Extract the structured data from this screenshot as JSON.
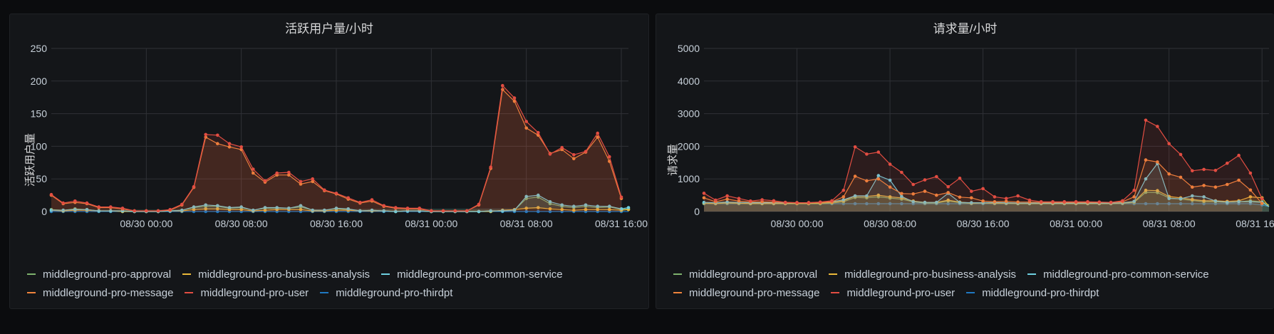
{
  "colors": {
    "middleground-pro-approval": "#7eb26d",
    "middleground-pro-business-analysis": "#eab839",
    "middleground-pro-common-service": "#6ed0e0",
    "middleground-pro-message": "#ef843c",
    "middleground-pro-user": "#e24d42",
    "middleground-pro-thirdpt": "#1f78c1"
  },
  "chart_data": [
    {
      "type": "area",
      "title": "活跃用户量/小时",
      "ylabel": "活跃用户量",
      "xlabel": "",
      "ylim": [
        0,
        250
      ],
      "yticks": [
        0,
        50,
        100,
        150,
        200,
        250
      ],
      "xtick_labels": [
        "08/30 00:00",
        "08/30 08:00",
        "08/30 16:00",
        "08/31 00:00",
        "08/31 08:00",
        "08/31 16:00"
      ],
      "xtick_hours": [
        8,
        16,
        24,
        32,
        40,
        48
      ],
      "xlim_hours": [
        0,
        48.6
      ],
      "legend_position": "bottom",
      "grid": true,
      "x_hours": [
        0,
        1,
        2,
        3,
        4,
        5,
        6,
        7,
        8,
        9,
        10,
        11,
        12,
        13,
        14,
        15,
        16,
        17,
        18,
        19,
        20,
        21,
        22,
        23,
        24,
        25,
        26,
        27,
        28,
        29,
        30,
        31,
        32,
        33,
        34,
        35,
        36,
        37,
        38,
        39,
        40,
        41,
        42,
        43,
        44,
        45,
        46,
        47,
        48,
        48.6
      ],
      "series": [
        {
          "name": "middleground-pro-approval",
          "values": [
            3,
            2,
            4,
            3,
            1,
            1,
            1,
            0,
            0,
            0,
            1,
            2,
            6,
            8,
            8,
            5,
            6,
            2,
            5,
            5,
            5,
            7,
            2,
            2,
            4,
            3,
            1,
            2,
            1,
            0,
            1,
            1,
            0,
            0,
            0,
            0,
            0,
            1,
            1,
            2,
            20,
            22,
            12,
            8,
            6,
            8,
            6,
            7,
            3,
            4,
            0
          ]
        },
        {
          "name": "middleground-pro-business-analysis",
          "values": [
            2,
            1,
            2,
            2,
            1,
            1,
            0,
            0,
            0,
            0,
            1,
            1,
            3,
            4,
            4,
            3,
            3,
            1,
            2,
            3,
            3,
            3,
            1,
            1,
            2,
            2,
            1,
            1,
            1,
            0,
            1,
            1,
            0,
            0,
            0,
            0,
            0,
            0,
            2,
            3,
            5,
            6,
            4,
            3,
            2,
            3,
            3,
            3,
            2,
            3,
            0
          ]
        },
        {
          "name": "middleground-pro-common-service",
          "values": [
            2,
            2,
            3,
            3,
            1,
            1,
            1,
            0,
            0,
            0,
            1,
            2,
            7,
            10,
            9,
            6,
            7,
            2,
            6,
            6,
            5,
            9,
            2,
            2,
            5,
            4,
            1,
            2,
            1,
            0,
            1,
            1,
            0,
            0,
            0,
            0,
            0,
            1,
            1,
            2,
            23,
            25,
            15,
            10,
            8,
            10,
            8,
            8,
            4,
            6,
            0
          ]
        },
        {
          "name": "middleground-pro-message",
          "values": [
            25,
            12,
            14,
            12,
            6,
            6,
            4,
            1,
            1,
            1,
            2,
            10,
            37,
            114,
            104,
            99,
            95,
            59,
            45,
            56,
            56,
            42,
            46,
            32,
            27,
            19,
            13,
            16,
            8,
            5,
            4,
            4,
            1,
            1,
            1,
            1,
            10,
            66,
            187,
            169,
            128,
            117,
            89,
            95,
            81,
            91,
            114,
            77,
            20
          ]
        },
        {
          "name": "middleground-pro-user",
          "values": [
            26,
            13,
            16,
            13,
            7,
            7,
            5,
            1,
            1,
            1,
            3,
            11,
            38,
            118,
            117,
            104,
            99,
            65,
            47,
            59,
            60,
            46,
            50,
            33,
            28,
            21,
            14,
            18,
            9,
            6,
            5,
            5,
            1,
            1,
            1,
            1,
            11,
            68,
            193,
            174,
            138,
            121,
            88,
            98,
            87,
            92,
            120,
            84,
            22
          ]
        },
        {
          "name": "middleground-pro-thirdpt",
          "values": [
            0,
            0,
            0,
            0,
            0,
            0,
            0,
            0,
            0,
            0,
            0,
            0,
            0,
            0,
            0,
            0,
            0,
            0,
            0,
            0,
            0,
            0,
            0,
            0,
            0,
            0,
            0,
            0,
            0,
            0,
            0,
            0,
            0,
            0,
            0,
            0,
            0,
            0,
            0,
            0,
            0,
            0,
            0,
            0,
            0,
            0,
            0,
            0,
            0,
            0
          ]
        }
      ]
    },
    {
      "type": "area",
      "title": "请求量/小时",
      "ylabel": "请求量",
      "xlabel": "",
      "ylim": [
        0,
        5000
      ],
      "yticks": [
        0,
        1000,
        2000,
        3000,
        4000,
        5000
      ],
      "xtick_labels": [
        "08/30 00:00",
        "08/30 08:00",
        "08/30 16:00",
        "08/31 00:00",
        "08/31 08:00",
        "08/31 16:00"
      ],
      "xtick_hours": [
        8,
        16,
        24,
        32,
        40,
        48
      ],
      "xlim_hours": [
        0,
        48.6
      ],
      "legend_position": "bottom",
      "grid": true,
      "x_hours": [
        0,
        1,
        2,
        3,
        4,
        5,
        6,
        7,
        8,
        9,
        10,
        11,
        12,
        13,
        14,
        15,
        16,
        17,
        18,
        19,
        20,
        21,
        22,
        23,
        24,
        25,
        26,
        27,
        28,
        29,
        30,
        31,
        32,
        33,
        34,
        35,
        36,
        37,
        38,
        39,
        40,
        41,
        42,
        43,
        44,
        45,
        46,
        47,
        48,
        48.6
      ],
      "series": [
        {
          "name": "middleground-pro-approval",
          "values": [
            250,
            240,
            260,
            250,
            240,
            240,
            240,
            240,
            240,
            240,
            240,
            260,
            300,
            430,
            420,
            450,
            410,
            380,
            300,
            260,
            260,
            320,
            270,
            250,
            260,
            250,
            250,
            240,
            240,
            240,
            240,
            240,
            240,
            240,
            240,
            240,
            250,
            280,
            590,
            580,
            420,
            380,
            340,
            300,
            300,
            280,
            300,
            330,
            300,
            200
          ]
        },
        {
          "name": "middleground-pro-business-analysis",
          "values": [
            260,
            250,
            270,
            260,
            250,
            250,
            250,
            250,
            250,
            250,
            260,
            280,
            330,
            470,
            460,
            500,
            450,
            420,
            320,
            280,
            280,
            350,
            290,
            260,
            270,
            260,
            260,
            250,
            250,
            250,
            250,
            250,
            250,
            250,
            250,
            250,
            260,
            300,
            650,
            640,
            460,
            420,
            370,
            330,
            330,
            310,
            330,
            450,
            420,
            150
          ]
        },
        {
          "name": "middleground-pro-common-service",
          "values": [
            280,
            270,
            290,
            280,
            270,
            270,
            270,
            270,
            270,
            270,
            280,
            300,
            360,
            480,
            480,
            1100,
            960,
            460,
            300,
            280,
            280,
            560,
            280,
            270,
            270,
            280,
            270,
            260,
            260,
            260,
            260,
            260,
            260,
            260,
            260,
            260,
            270,
            310,
            1000,
            1470,
            400,
            390,
            480,
            450,
            320,
            280,
            300,
            300,
            280,
            150
          ]
        },
        {
          "name": "middleground-pro-message",
          "values": [
            420,
            300,
            380,
            320,
            300,
            300,
            290,
            280,
            270,
            270,
            280,
            300,
            450,
            1080,
            940,
            1000,
            750,
            550,
            540,
            620,
            500,
            580,
            440,
            420,
            320,
            300,
            310,
            290,
            290,
            280,
            280,
            280,
            280,
            280,
            280,
            280,
            300,
            450,
            1580,
            1520,
            1150,
            1050,
            750,
            800,
            750,
            830,
            960,
            660,
            250
          ]
        },
        {
          "name": "middleground-pro-user",
          "values": [
            560,
            350,
            480,
            400,
            320,
            360,
            330,
            280,
            270,
            270,
            290,
            330,
            650,
            1980,
            1760,
            1820,
            1450,
            1200,
            830,
            970,
            1070,
            760,
            1020,
            620,
            700,
            450,
            400,
            480,
            350,
            300,
            300,
            300,
            300,
            300,
            290,
            280,
            330,
            650,
            2800,
            2610,
            2080,
            1750,
            1250,
            1290,
            1260,
            1480,
            1720,
            1180,
            390
          ]
        },
        {
          "name": "middleground-pro-thirdpt",
          "values": [
            240,
            240,
            240,
            240,
            240,
            240,
            240,
            240,
            240,
            240,
            240,
            240,
            240,
            240,
            240,
            240,
            240,
            240,
            240,
            240,
            240,
            240,
            240,
            240,
            240,
            240,
            240,
            240,
            240,
            240,
            240,
            240,
            240,
            240,
            240,
            240,
            240,
            240,
            240,
            240,
            240,
            240,
            240,
            240,
            240,
            240,
            240,
            240,
            200,
            150
          ]
        }
      ]
    }
  ]
}
